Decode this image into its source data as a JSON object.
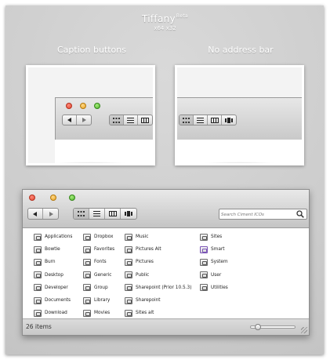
{
  "header": {
    "title": "Tiffany",
    "title_sup": "Beta",
    "subtitle": "x64 x32"
  },
  "previews": {
    "left_caption": "Caption buttons",
    "right_caption": "No address bar"
  },
  "window": {
    "search_placeholder": "Search Ciment ICOs",
    "status": "26 items",
    "slider_level": 0.1,
    "view_modes": [
      "icon-view",
      "list-view",
      "column-view",
      "coverflow-view"
    ],
    "active_view": "icon-view",
    "items_col1": [
      "Applications",
      "Bowtie",
      "Burn",
      "Desktop",
      "Developer",
      "Documents",
      "Download"
    ],
    "items_col2": [
      "Dropbox",
      "Favorites",
      "Fonts",
      "Generic",
      "Group",
      "Library",
      "Movies"
    ],
    "items_col3": [
      "Music",
      "Pictures Alt",
      "Pictures",
      "Public",
      "Sharepoint (Prior 10.5.3)",
      "Sharepoint",
      "Sites alt"
    ],
    "items_col4": [
      "Sites",
      "Smart",
      "System",
      "User",
      "Utilities"
    ]
  },
  "colors": {
    "background": "#cfcfcf",
    "accent_purple": "#7b55b6",
    "close": "#e0452f",
    "minimize": "#e7a21f",
    "zoom": "#4db42b"
  }
}
